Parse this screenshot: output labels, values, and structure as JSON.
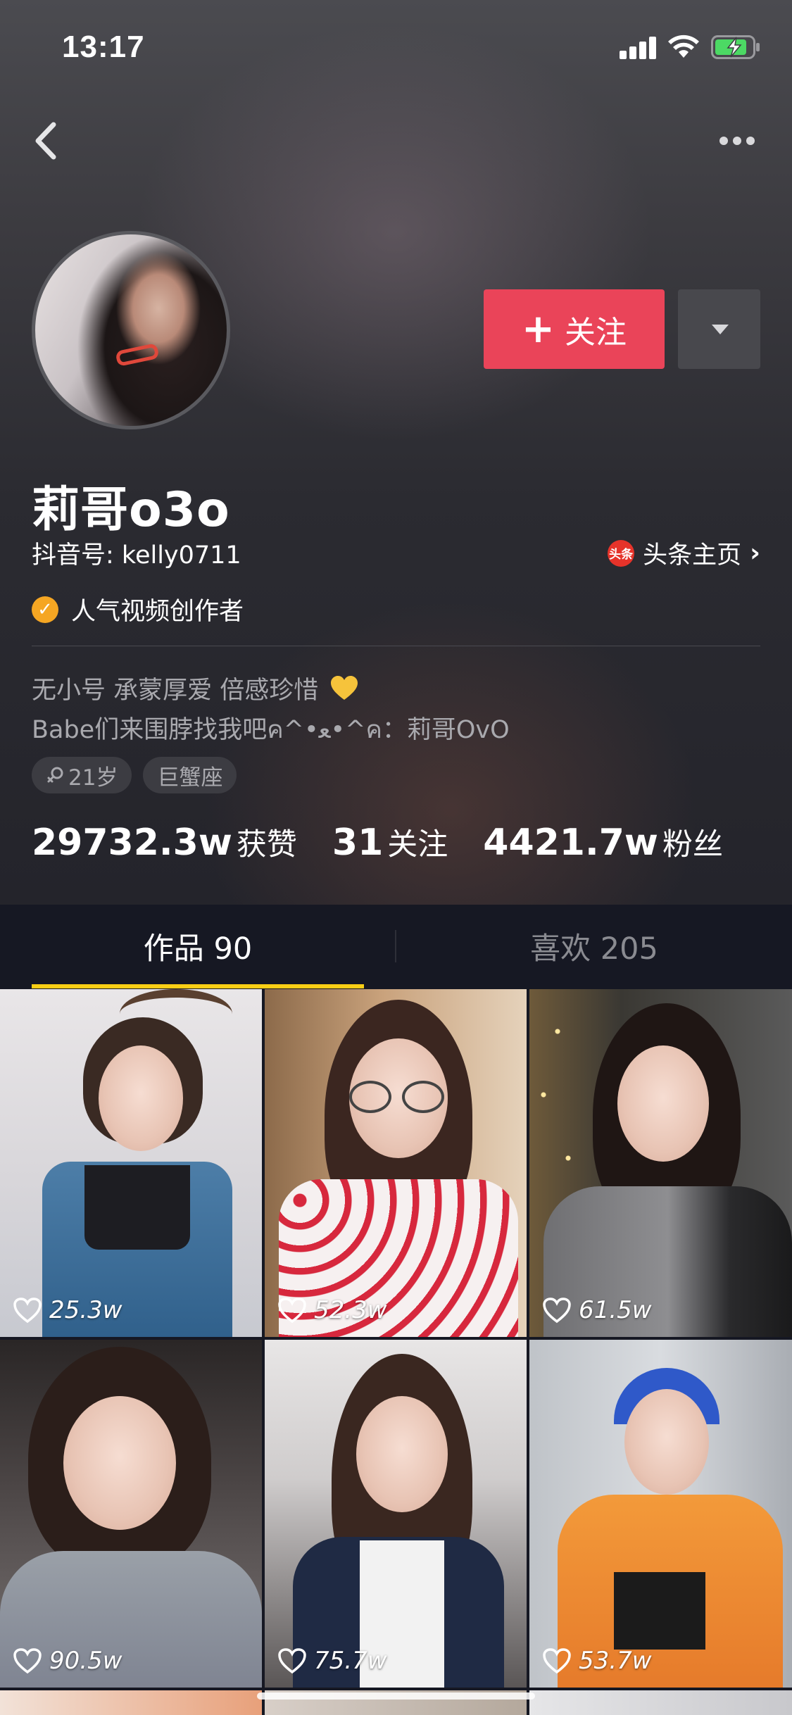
{
  "status_bar": {
    "time": "13:17",
    "icons": [
      "signal-icon",
      "wifi-icon",
      "battery-charging-icon"
    ]
  },
  "nav": {
    "back_icon": "chevron-left-icon",
    "more_icon": "more-horizontal-icon"
  },
  "profile": {
    "nickname": "莉哥o3o",
    "douyin_id": "抖音号: kelly0711",
    "toutiao_label": "头条主页",
    "toutiao_logo_text": "头条",
    "verified_label": "人气视频创作者",
    "bio_line1": "无小号 承蒙厚爱 倍感珍惜",
    "bio_line2": "Babe们来围脖找我吧ค^•ﻌ•^ค：莉哥OvO",
    "tags": [
      "21岁",
      "巨蟹座"
    ],
    "follow_label": "关注",
    "colors": {
      "follow": "#ea4459",
      "verified": "#f5a623",
      "tab_indicator": "#face15"
    }
  },
  "stats": [
    {
      "value": "29732.3w",
      "label": "获赞"
    },
    {
      "value": "31",
      "label": "关注"
    },
    {
      "value": "4421.7w",
      "label": "粉丝"
    }
  ],
  "tabs": [
    {
      "label": "作品 90",
      "active": true
    },
    {
      "label": "喜欢 205",
      "active": false
    }
  ],
  "videos": [
    {
      "likes": "25.3w"
    },
    {
      "likes": "52.3w"
    },
    {
      "likes": "61.5w"
    },
    {
      "likes": "90.5w"
    },
    {
      "likes": "75.7w"
    },
    {
      "likes": "53.7w"
    }
  ]
}
